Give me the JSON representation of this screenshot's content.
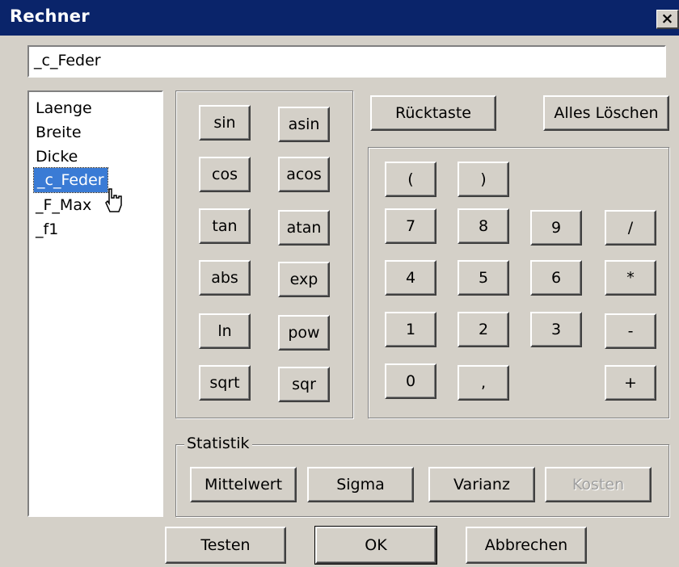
{
  "window": {
    "title": "Rechner",
    "close_symbol": "×"
  },
  "expression": {
    "value": "_c_Feder"
  },
  "variables": {
    "items": [
      "Laenge",
      "Breite",
      "Dicke",
      "_c_Feder",
      "_F_Max",
      "_f1"
    ],
    "selected_index": 3
  },
  "functions": [
    "sin",
    "asin",
    "cos",
    "acos",
    "tan",
    "atan",
    "abs",
    "exp",
    "ln",
    "pow",
    "sqrt",
    "sqr"
  ],
  "edit_buttons": {
    "backspace": "Rücktaste",
    "clear_all": "Alles Löschen"
  },
  "keypad": {
    "paren_open": "(",
    "paren_close": ")",
    "k7": "7",
    "k8": "8",
    "k9": "9",
    "divide": "/",
    "k4": "4",
    "k5": "5",
    "k6": "6",
    "multiply": "*",
    "k1": "1",
    "k2": "2",
    "k3": "3",
    "minus": "-",
    "k0": "0",
    "decimal": ",",
    "plus": "+"
  },
  "statistics": {
    "legend": "Statistik",
    "mean": "Mittelwert",
    "sigma": "Sigma",
    "variance": "Varianz",
    "cost": "Kosten"
  },
  "footer": {
    "test": "Testen",
    "ok": "OK",
    "cancel": "Abbrechen"
  },
  "colors": {
    "titlebar": "#0a246a",
    "face": "#d4d0c8",
    "selection": "#3a7bd5"
  }
}
